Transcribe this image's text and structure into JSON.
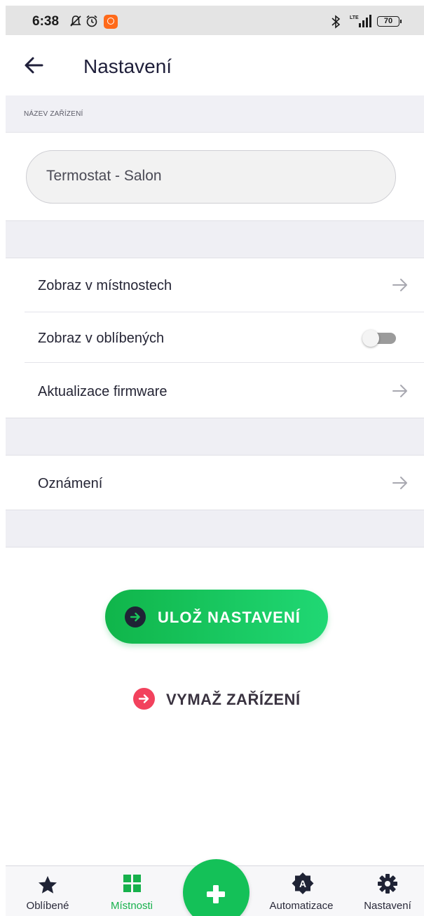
{
  "status_bar": {
    "time": "6:38",
    "network": "LTE",
    "battery": "70",
    "icons": [
      "muted-bell-icon",
      "alarm-icon",
      "app-notification-icon",
      "bluetooth-icon",
      "signal-icon",
      "battery-icon"
    ]
  },
  "header": {
    "title": "Nastavení",
    "back_icon": "arrow-left-icon"
  },
  "device_name": {
    "section_label": "NÁZEV ZAŘÍZENÍ",
    "value": "Termostat - Salon"
  },
  "settings_rows": [
    {
      "label": "Zobraz v místnostech",
      "control": "arrow-right-icon"
    },
    {
      "label": "Zobraz v oblíbených",
      "control": "toggle",
      "toggle_on": false
    },
    {
      "label": "Aktualizace firmware",
      "control": "arrow-right-icon"
    }
  ],
  "notifications_row": {
    "label": "Oznámení",
    "control": "arrow-right-icon"
  },
  "actions": {
    "save_label": "ULOŽ NASTAVENÍ",
    "delete_label": "VYMAŽ ZAŘÍZENÍ"
  },
  "bottom_nav": {
    "items": [
      {
        "label": "Oblíbené",
        "icon": "star-icon",
        "active": false
      },
      {
        "label": "Místnosti",
        "icon": "grid-icon",
        "active": true
      },
      {
        "label": "Automatizace",
        "icon": "automation-badge-icon",
        "active": false
      },
      {
        "label": "Nastavení",
        "icon": "gear-icon",
        "active": false
      }
    ],
    "fab_icon": "plus-icon"
  },
  "colors": {
    "accent_green": "#14c158",
    "delete_red": "#f2425d",
    "dark": "#1f2335"
  }
}
